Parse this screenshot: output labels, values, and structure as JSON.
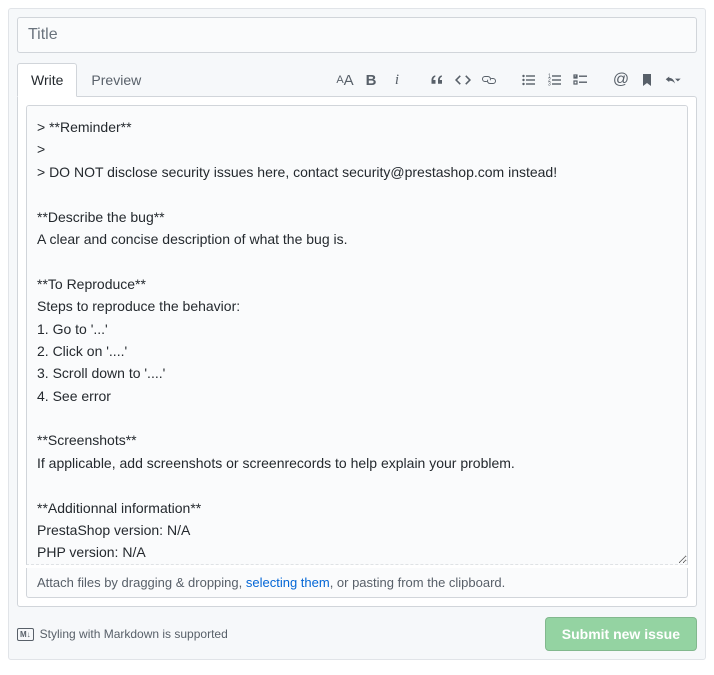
{
  "title_placeholder": "Title",
  "tabs": {
    "write": "Write",
    "preview": "Preview"
  },
  "toolbar": {
    "heading": "Heading",
    "bold": "Bold",
    "italic": "Italic",
    "quote": "Quote",
    "code": "Code",
    "link": "Link",
    "ul": "Bulleted list",
    "ol": "Numbered list",
    "tasks": "Task list",
    "mention": "Mention",
    "ref": "Reference",
    "saved": "Saved replies"
  },
  "body": "> **Reminder**\n>\n> DO NOT disclose security issues here, contact security@prestashop.com instead!\n\n**Describe the bug**\nA clear and concise description of what the bug is.\n\n**To Reproduce**\nSteps to reproduce the behavior:\n1. Go to '...'\n2. Click on '....'\n3. Scroll down to '....'\n4. See error\n\n**Screenshots**\nIf applicable, add screenshots or screenrecords to help explain your problem.\n\n**Additionnal information**\nPrestaShop version: N/A\nPHP version: N/A",
  "attach": {
    "before": "Attach files by dragging & dropping, ",
    "link": "selecting them",
    "after": ", or pasting from the clipboard."
  },
  "markdown_hint": "Styling with Markdown is supported",
  "submit_label": "Submit new issue"
}
